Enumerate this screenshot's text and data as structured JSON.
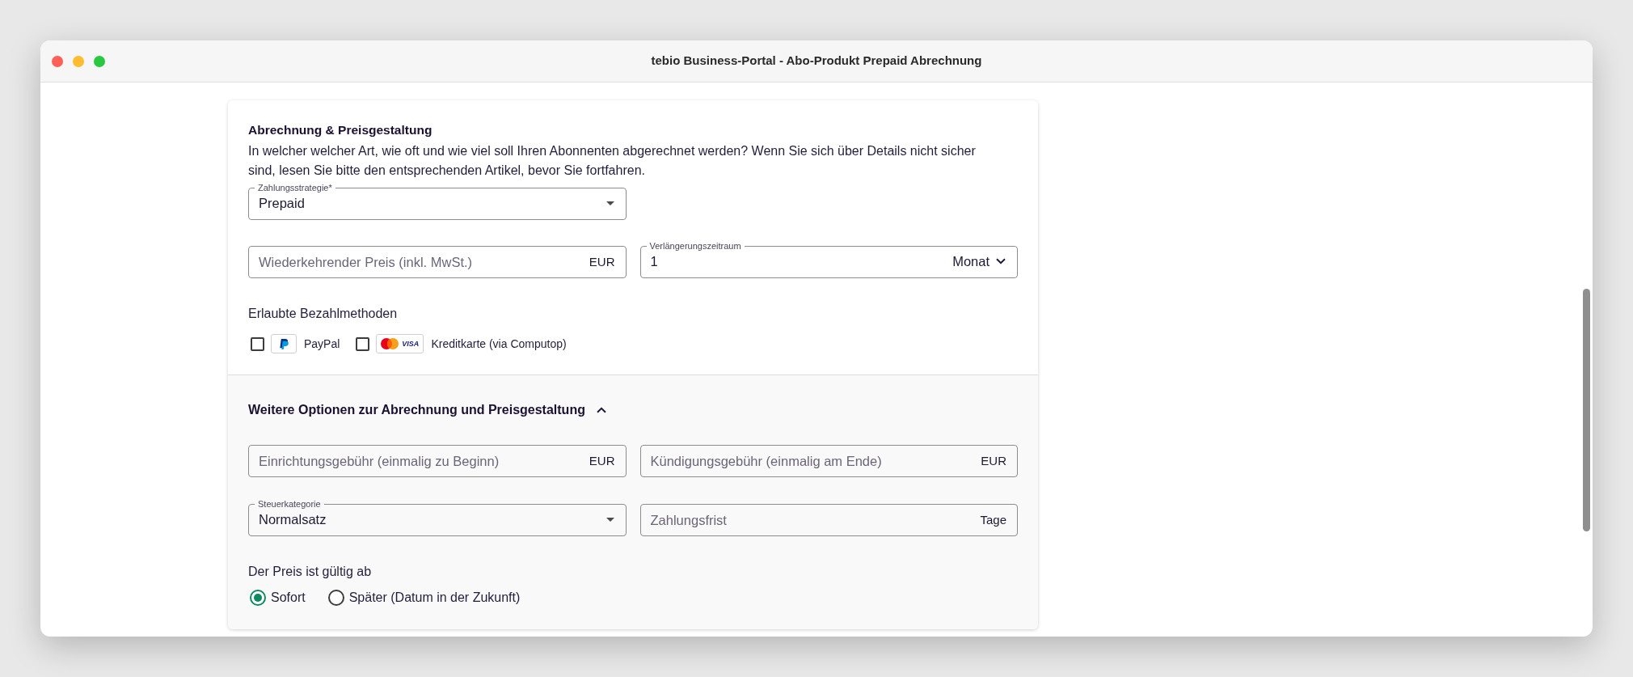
{
  "window": {
    "title": "tebio Business-Portal - Abo-Produkt Prepaid Abrechnung"
  },
  "billing": {
    "heading": "Abrechnung & Preisgestaltung",
    "description": "In welcher welcher Art, wie oft und wie viel soll Ihren Abonnenten abgerechnet werden? Wenn Sie sich über Details nicht sicher sind, lesen Sie bitte den entsprechenden Artikel, bevor Sie fortfahren.",
    "strategy": {
      "kind": "select",
      "label": "Zahlungsstrategie*",
      "value": "Prepaid"
    },
    "fields": [
      {
        "kind": "amount",
        "placeholder": "Wiederkehrender Preis (inkl. MwSt.)",
        "unit": "EUR"
      },
      {
        "kind": "period",
        "label": "Verlängerungszeitraum",
        "value": "1",
        "unit": "Monat"
      }
    ],
    "payment_methods": {
      "label": "Erlaubte Bezahlmethoden",
      "options": [
        {
          "kind": "paypal",
          "label": "PayPal",
          "checked": false
        },
        {
          "kind": "cards",
          "logo_text": "VISA",
          "label": "Kreditkarte (via Computop)",
          "checked": false
        }
      ]
    }
  },
  "more_options": {
    "heading": "Weitere Optionen zur Abrechnung und Preisgestaltung",
    "expanded": true,
    "fields": [
      {
        "kind": "amount",
        "placeholder": "Einrichtungsgebühr (einmalig zu Beginn)",
        "unit": "EUR"
      },
      {
        "kind": "amount",
        "placeholder": "Kündigungsgebühr (einmalig am Ende)",
        "unit": "EUR"
      },
      {
        "kind": "select",
        "label": "Steuerkategorie",
        "value": "Normalsatz"
      },
      {
        "kind": "amount",
        "placeholder": "Zahlungsfrist",
        "unit": "Tage"
      }
    ],
    "valid_from": {
      "label": "Der Preis ist gültig ab",
      "options": [
        {
          "label": "Sofort",
          "selected": true
        },
        {
          "label": "Später (Datum in der Zukunft)",
          "selected": false
        }
      ]
    }
  }
}
